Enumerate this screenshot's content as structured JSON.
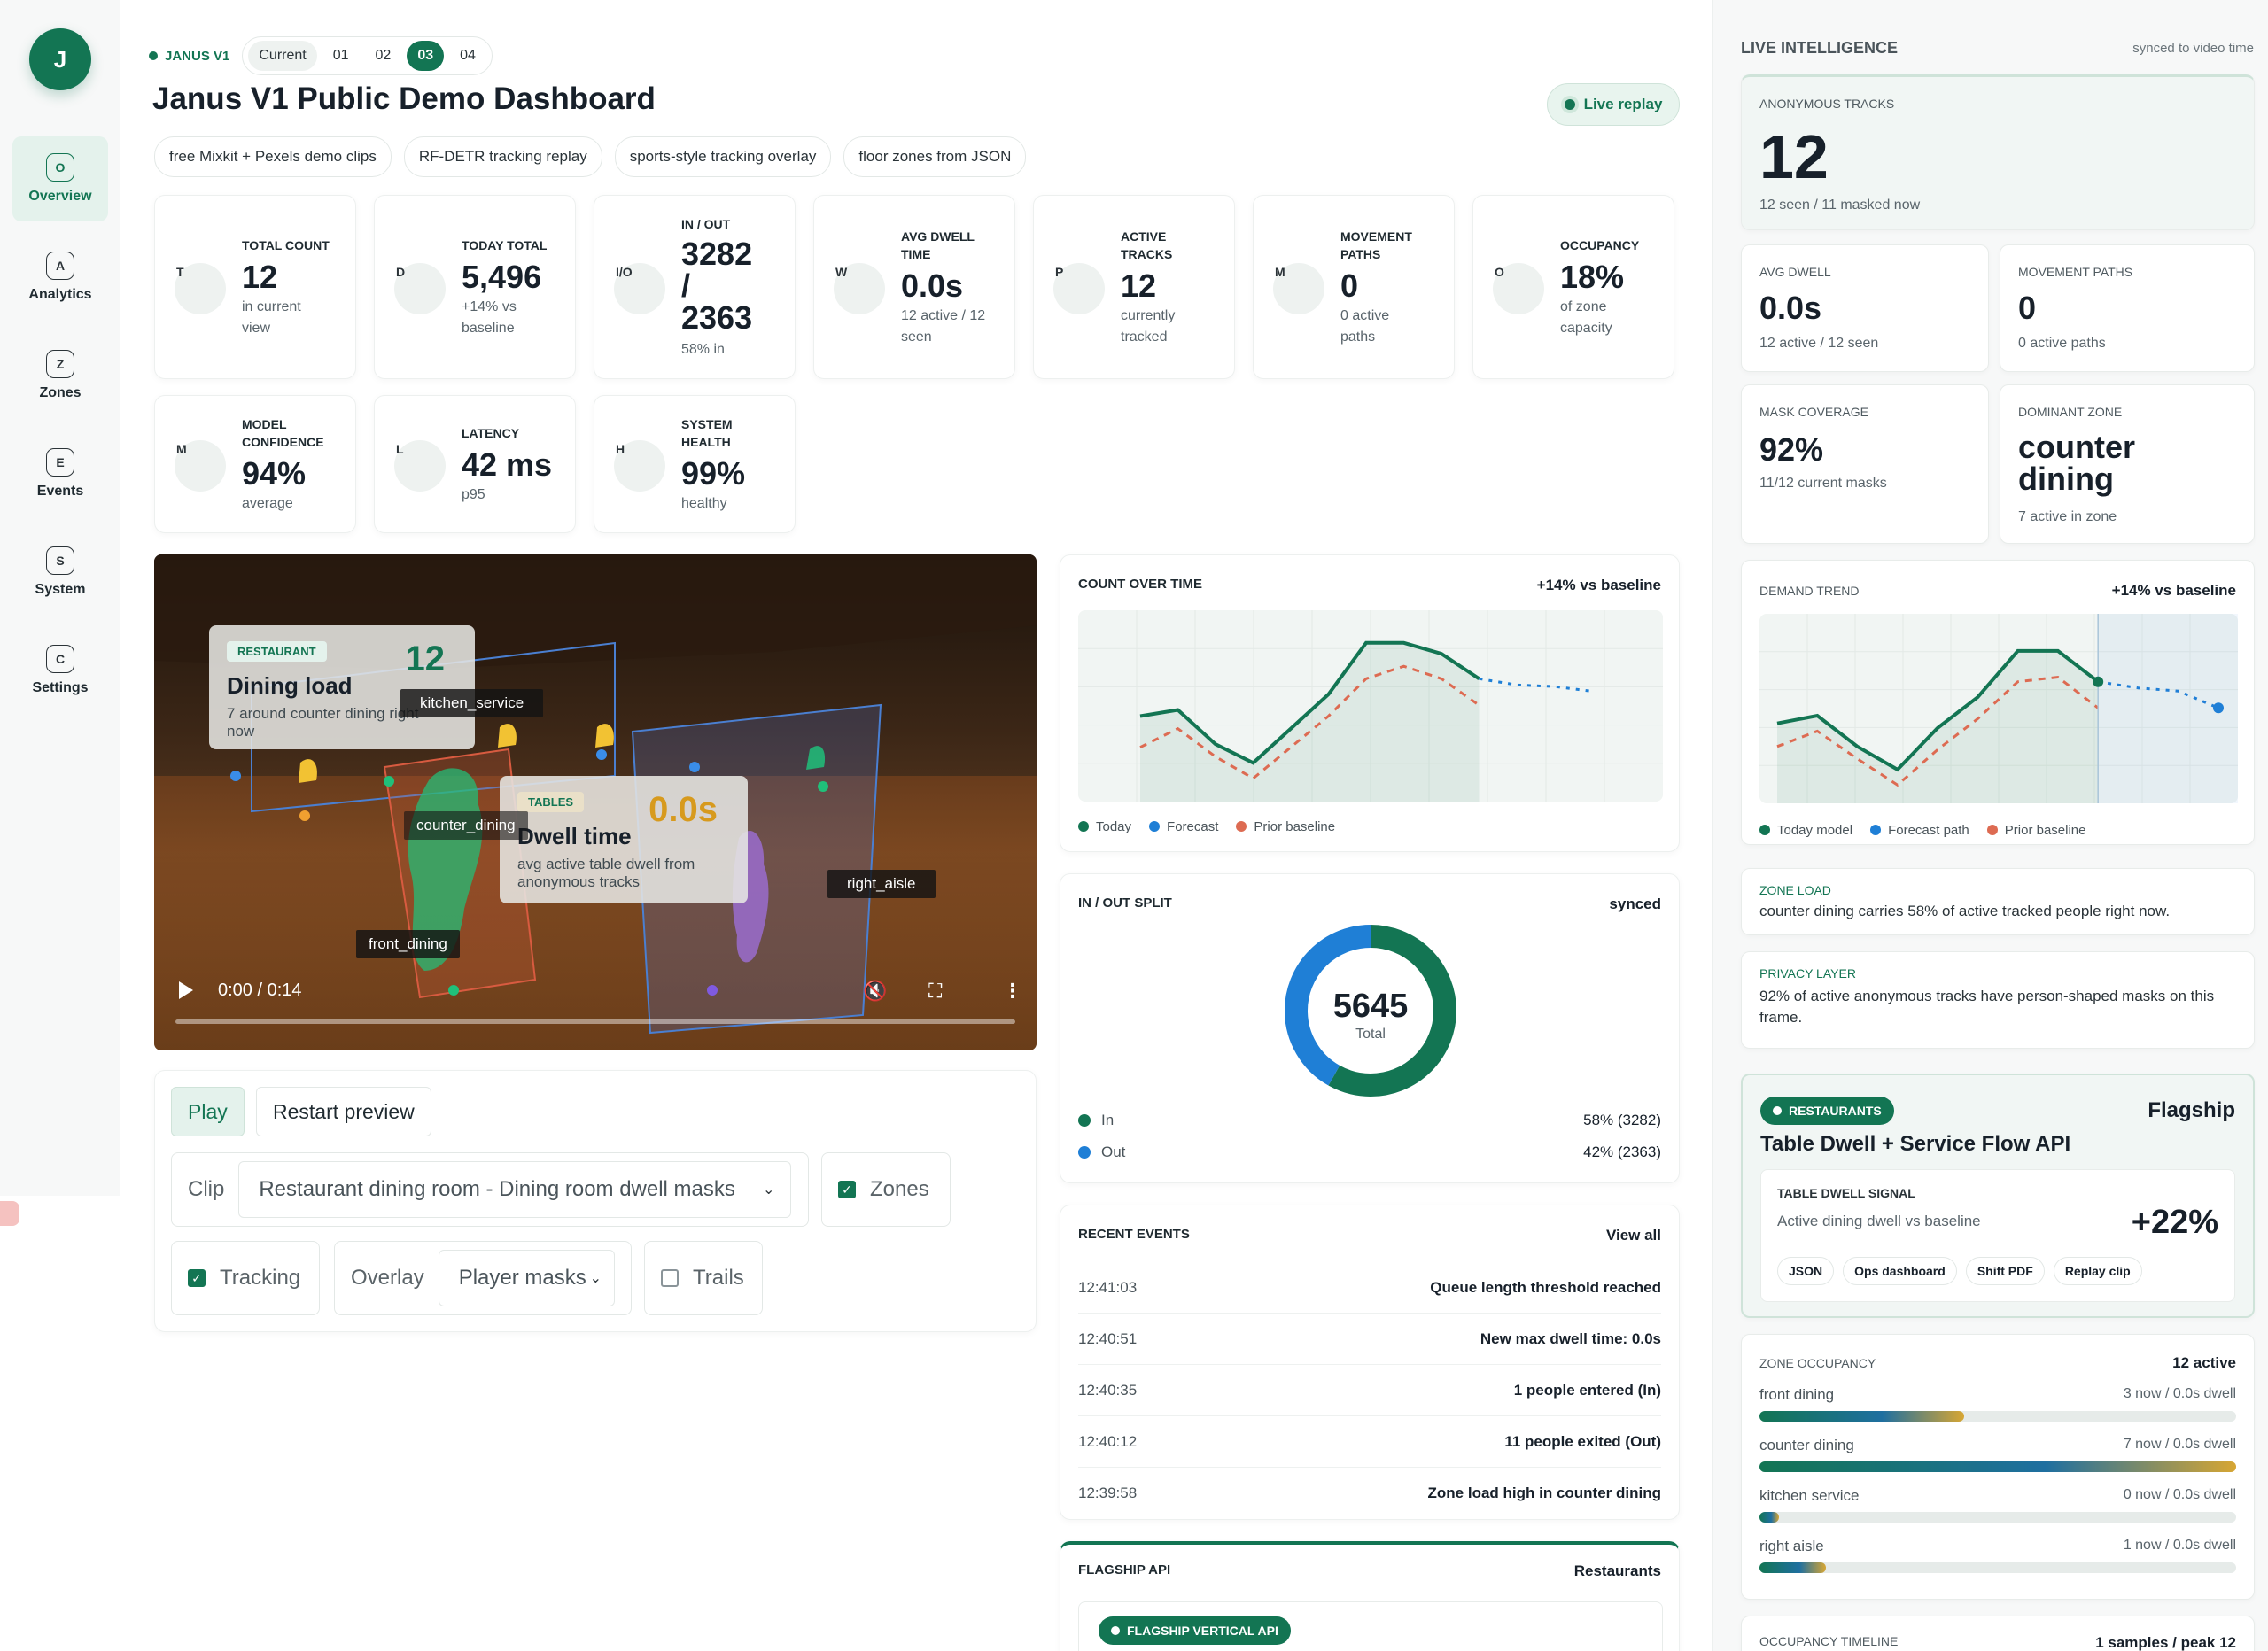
{
  "sidebar": {
    "logo": "J",
    "items": [
      {
        "letter": "O",
        "label": "Overview",
        "active": true
      },
      {
        "letter": "A",
        "label": "Analytics"
      },
      {
        "letter": "Z",
        "label": "Zones"
      },
      {
        "letter": "E",
        "label": "Events"
      },
      {
        "letter": "S",
        "label": "System"
      },
      {
        "letter": "C",
        "label": "Settings"
      }
    ]
  },
  "header": {
    "brand": "JANUS V1",
    "versions": [
      "Current",
      "01",
      "02",
      "03",
      "04"
    ],
    "selected_version": "03",
    "title": "Janus V1 Public Demo Dashboard",
    "live_label": "Live replay",
    "chips": [
      "free Mixkit + Pexels demo clips",
      "RF-DETR tracking replay",
      "sports-style tracking overlay",
      "floor zones from JSON"
    ]
  },
  "kpis": [
    {
      "letter": "T",
      "label": "TOTAL COUNT",
      "value": "12",
      "sub": "in current view"
    },
    {
      "letter": "D",
      "label": "TODAY TOTAL",
      "value": "5,496",
      "sub": "+14% vs baseline"
    },
    {
      "letter": "I/O",
      "label": "IN / OUT",
      "value": "3282 / 2363",
      "sub": "58% in"
    },
    {
      "letter": "W",
      "label": "AVG DWELL TIME",
      "value": "0.0s",
      "sub": "12 active / 12 seen"
    },
    {
      "letter": "P",
      "label": "ACTIVE TRACKS",
      "value": "12",
      "sub": "currently tracked"
    },
    {
      "letter": "M",
      "label": "MOVEMENT PATHS",
      "value": "0",
      "sub": "0 active paths"
    },
    {
      "letter": "O",
      "label": "OCCUPANCY",
      "value": "18%",
      "sub": "of zone capacity"
    },
    {
      "letter": "M",
      "label": "MODEL CONFIDENCE",
      "value": "94%",
      "sub": "average"
    },
    {
      "letter": "L",
      "label": "LATENCY",
      "value": "42 ms",
      "sub": "p95"
    },
    {
      "letter": "H",
      "label": "SYSTEM HEALTH",
      "value": "99%",
      "sub": "healthy"
    }
  ],
  "video": {
    "card1": {
      "tag": "RESTAURANT",
      "title": "Dining load",
      "sub": "7 around counter dining right now",
      "num": "12"
    },
    "card2": {
      "tag": "TABLES",
      "title": "Dwell time",
      "sub": "avg active table dwell from anonymous tracks",
      "num": "0.0s"
    },
    "labels": [
      "kitchen_service",
      "counter_dining",
      "front_dining",
      "right_aisle"
    ],
    "time": "0:00 / 0:14"
  },
  "controls": {
    "play": "Play",
    "restart": "Restart preview",
    "clip_label": "Clip",
    "clip_value": "Restaurant dining room - Dining room dwell masks",
    "zones": "Zones",
    "tracking": "Tracking",
    "overlay_label": "Overlay",
    "overlay_value": "Player masks",
    "trails": "Trails"
  },
  "count_chart": {
    "title": "COUNT OVER TIME",
    "right": "+14% vs baseline",
    "legend": [
      "Today",
      "Forecast",
      "Prior baseline"
    ]
  },
  "chart_data": [
    {
      "type": "line",
      "title": "COUNT OVER TIME",
      "series": [
        {
          "name": "Today",
          "values": [
            0.48,
            0.52,
            0.3,
            0.18,
            0.4,
            0.62,
            0.95,
            0.95,
            0.88,
            0.72
          ]
        },
        {
          "name": "Forecast",
          "values": [
            null,
            null,
            null,
            null,
            null,
            null,
            null,
            null,
            null,
            0.72,
            0.68,
            0.67,
            0.64
          ]
        },
        {
          "name": "Prior baseline",
          "values": [
            0.28,
            0.4,
            0.22,
            0.08,
            0.28,
            0.48,
            0.72,
            0.8,
            0.72,
            0.55
          ]
        }
      ]
    },
    {
      "type": "pie",
      "title": "IN / OUT SPLIT",
      "center_value": "5645",
      "center_label": "Total",
      "slices": [
        {
          "name": "In",
          "value": 3282,
          "pct": "58%",
          "color": "#137553"
        },
        {
          "name": "Out",
          "value": 2363,
          "pct": "42%",
          "color": "#1f7fd6"
        }
      ]
    },
    {
      "type": "line",
      "title": "DEMAND TREND",
      "series": [
        {
          "name": "Today model",
          "values": [
            0.45,
            0.5,
            0.3,
            0.15,
            0.42,
            0.62,
            0.92,
            0.92,
            0.72
          ]
        },
        {
          "name": "Forecast path",
          "values": [
            null,
            null,
            null,
            null,
            null,
            null,
            null,
            null,
            0.72,
            0.68,
            0.66,
            0.55
          ]
        },
        {
          "name": "Prior baseline",
          "values": [
            0.3,
            0.4,
            0.22,
            0.05,
            0.28,
            0.48,
            0.72,
            0.75,
            0.55
          ]
        }
      ]
    }
  ],
  "split": {
    "title": "IN / OUT SPLIT",
    "right": "synced",
    "in_label": "In",
    "in_value": "58% (3282)",
    "out_label": "Out",
    "out_value": "42% (2363)",
    "total": "5645",
    "total_label": "Total"
  },
  "events": {
    "title": "RECENT EVENTS",
    "link": "View all",
    "rows": [
      {
        "time": "12:41:03",
        "text": "Queue length threshold reached"
      },
      {
        "time": "12:40:51",
        "text": "New max dwell time: 0.0s"
      },
      {
        "time": "12:40:35",
        "text": "1 people entered (In)"
      },
      {
        "time": "12:40:12",
        "text": "11 people exited (Out)"
      },
      {
        "time": "12:39:58",
        "text": "Zone load high in counter dining"
      }
    ]
  },
  "flagship_api": {
    "title": "FLAGSHIP API",
    "right": "Restaurants",
    "badge": "FLAGSHIP VERTICAL API"
  },
  "right": {
    "title": "LIVE INTELLIGENCE",
    "sync": "synced to video time",
    "tracks": {
      "label": "ANONYMOUS TRACKS",
      "value": "12",
      "sub": "12 seen / 11 masked now"
    },
    "avg_dwell": {
      "label": "AVG DWELL",
      "value": "0.0s",
      "sub": "12 active / 12 seen"
    },
    "movement": {
      "label": "MOVEMENT PATHS",
      "value": "0",
      "sub": "0 active paths"
    },
    "mask": {
      "label": "MASK COVERAGE",
      "value": "92%",
      "sub": "11/12 current masks"
    },
    "dominant": {
      "label": "DOMINANT ZONE",
      "value": "counter dining",
      "sub": "7 active in zone"
    },
    "demand": {
      "label": "DEMAND TREND",
      "right": "+14% vs baseline",
      "legend": [
        "Today model",
        "Forecast path",
        "Prior baseline"
      ]
    },
    "zone_load": {
      "label": "ZONE LOAD",
      "text": "counter dining carries 58% of active tracked people right now."
    },
    "privacy": {
      "label": "PRIVACY LAYER",
      "text": "92% of active anonymous tracks have person-shaped masks on this frame."
    },
    "flagship": {
      "badge": "RESTAURANTS",
      "right": "Flagship",
      "title": "Table Dwell + Service Flow API",
      "signal_label": "TABLE DWELL SIGNAL",
      "signal_sub": "Active dining dwell vs baseline",
      "signal_value": "+22%",
      "tags": [
        "JSON",
        "Ops dashboard",
        "Shift PDF",
        "Replay clip"
      ]
    },
    "zones": {
      "label": "ZONE OCCUPANCY",
      "right": "12 active",
      "rows": [
        {
          "name": "front dining",
          "value": "3 now / 0.0s dwell",
          "level": 0.43
        },
        {
          "name": "counter dining",
          "value": "7 now / 0.0s dwell",
          "level": 1.0
        },
        {
          "name": "kitchen service",
          "value": "0 now / 0.0s dwell",
          "level": 0.04
        },
        {
          "name": "right aisle",
          "value": "1 now / 0.0s dwell",
          "level": 0.14
        }
      ]
    },
    "timeline": {
      "label": "OCCUPANCY TIMELINE",
      "right": "1 samples / peak 12"
    }
  }
}
